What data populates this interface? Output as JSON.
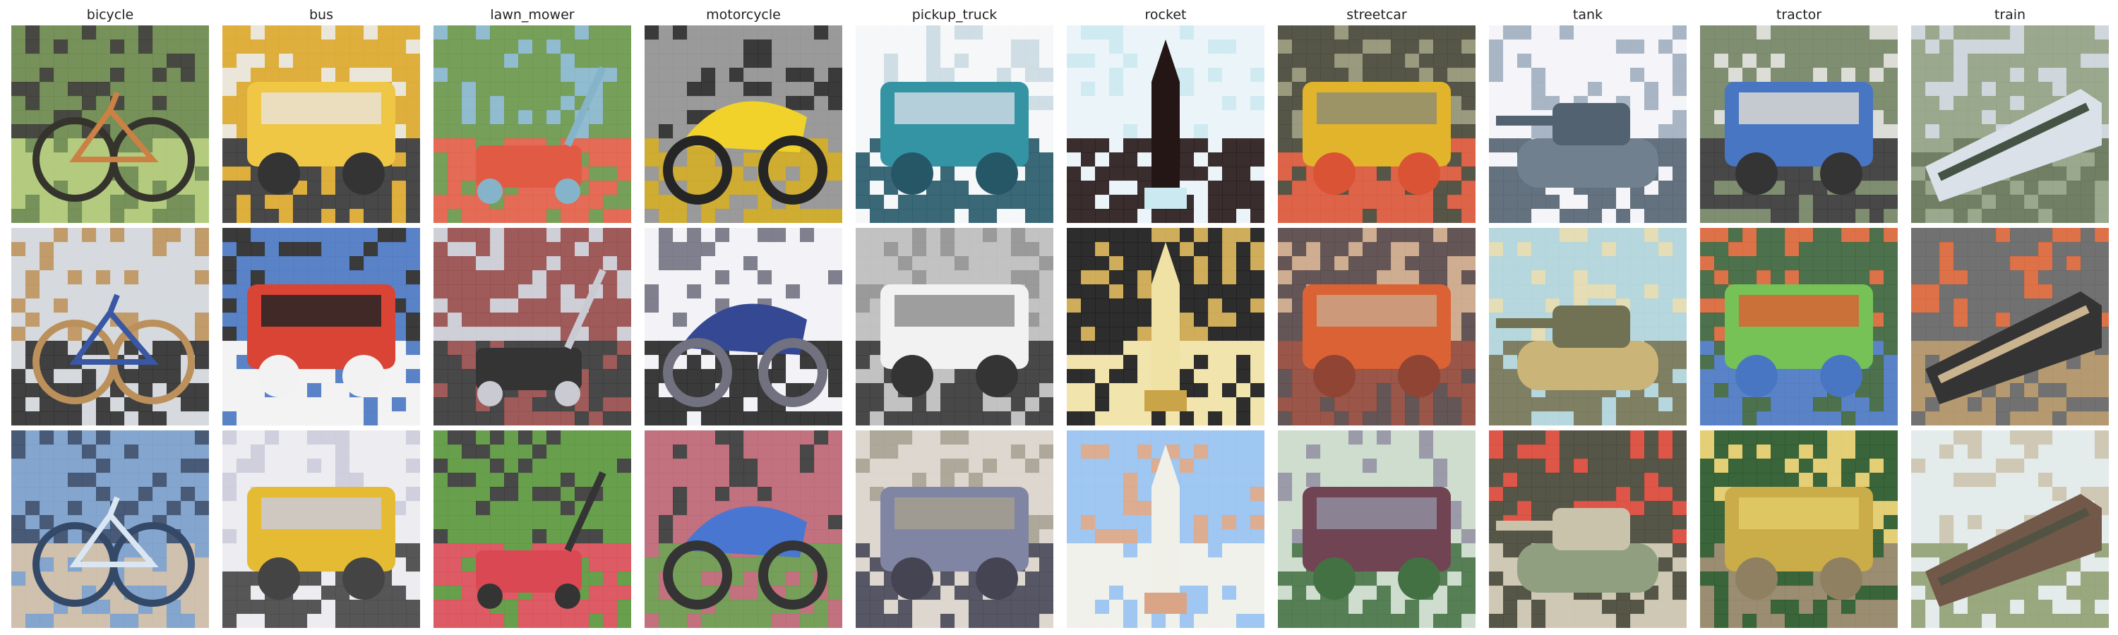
{
  "figure": {
    "columns": [
      {
        "label": "bicycle",
        "images": [
          {
            "subject": "bicycle",
            "palette": [
              "#5f7f3e",
              "#3f5a2a",
              "#a7c36a",
              "#2a2a22",
              "#c97a3a"
            ],
            "kind": "bike"
          },
          {
            "subject": "bicycle",
            "palette": [
              "#cfd5da",
              "#6a5638",
              "#202020",
              "#b88b52",
              "#2f4f9f"
            ],
            "kind": "bike"
          },
          {
            "subject": "bicycle",
            "palette": [
              "#6f97c7",
              "#9fb7cf",
              "#c8b7a0",
              "#2a3f5f",
              "#d8e6f2"
            ],
            "kind": "bike"
          }
        ]
      },
      {
        "label": "bus",
        "images": [
          {
            "subject": "bus",
            "palette": [
              "#d9a21d",
              "#f0c33b",
              "#2a2a2a",
              "#e8e2d4",
              "#7a5a1a"
            ],
            "kind": "vehicle"
          },
          {
            "subject": "bus",
            "palette": [
              "#3f6fbf",
              "#d83a2a",
              "#f2f2f2",
              "#1a1a1a",
              "#7ea7df"
            ],
            "kind": "vehicle"
          },
          {
            "subject": "bus",
            "palette": [
              "#e9e9ef",
              "#e3b828",
              "#3a3a3a",
              "#c8c8d8",
              "#6a5a2a"
            ],
            "kind": "vehicle"
          }
        ]
      },
      {
        "label": "lawn_mower",
        "images": [
          {
            "subject": "lawn_mower",
            "palette": [
              "#5f8f3f",
              "#3a5a2a",
              "#e0533a",
              "#7fb0c8",
              "#d8d2c0"
            ],
            "kind": "mower"
          },
          {
            "subject": "lawn_mower",
            "palette": [
              "#8f3f3f",
              "#6a9a4a",
              "#2a2a2a",
              "#c8c8d0",
              "#a05a4a"
            ],
            "kind": "mower"
          },
          {
            "subject": "lawn_mower",
            "palette": [
              "#4f8f2f",
              "#6fae3f",
              "#d8404a",
              "#2a2a2a",
              "#9fcf5f"
            ],
            "kind": "mower"
          }
        ]
      },
      {
        "label": "motorcycle",
        "images": [
          {
            "subject": "motorcycle",
            "palette": [
              "#8a8a8a",
              "#f0d020",
              "#c8a010",
              "#1a1a1a",
              "#d8d8d8"
            ],
            "kind": "moto"
          },
          {
            "subject": "motorcycle",
            "palette": [
              "#f2f2f6",
              "#2a3f8f",
              "#1a1a1a",
              "#6a6a7a",
              "#d8d2a0"
            ],
            "kind": "moto"
          },
          {
            "subject": "motorcycle",
            "palette": [
              "#b85a6a",
              "#3f6fcf",
              "#5f8f3f",
              "#2a2a2a",
              "#d8d8e0"
            ],
            "kind": "moto"
          }
        ]
      },
      {
        "label": "pickup_truck",
        "images": [
          {
            "subject": "pickup_truck",
            "palette": [
              "#f4f6f8",
              "#2a8fa0",
              "#1a4f5f",
              "#c8d8e0",
              "#2a2a2a"
            ],
            "kind": "vehicle"
          },
          {
            "subject": "pickup_truck",
            "palette": [
              "#b8b8b8",
              "#f2f2f2",
              "#2a2a2a",
              "#8a8a8a",
              "#6a7a5a"
            ],
            "kind": "vehicle"
          },
          {
            "subject": "pickup_truck",
            "palette": [
              "#d8d0c8",
              "#7a7fa0",
              "#3a3a4a",
              "#a09a8a",
              "#f0eee8"
            ],
            "kind": "vehicle"
          }
        ]
      },
      {
        "label": "rocket",
        "images": [
          {
            "subject": "rocket",
            "palette": [
              "#e8f4f8",
              "#4a1a1a",
              "#1a0a0a",
              "#c8e8f0",
              "#8a8a8a"
            ],
            "kind": "rocket"
          },
          {
            "subject": "rocket",
            "palette": [
              "#0a0a0a",
              "#1a1a0a",
              "#f0e0a0",
              "#c8a040",
              "#2a2a1a"
            ],
            "kind": "rocket"
          },
          {
            "subject": "rocket",
            "palette": [
              "#8fbfef",
              "#c8e0f8",
              "#f0f0e8",
              "#d8a080",
              "#6f9fdf"
            ],
            "kind": "rocket"
          }
        ]
      },
      {
        "label": "streetcar",
        "images": [
          {
            "subject": "streetcar",
            "palette": [
              "#3a3a2a",
              "#e0b020",
              "#d84a2a",
              "#8a8a6a",
              "#1a1a1a"
            ],
            "kind": "vehicle"
          },
          {
            "subject": "streetcar",
            "palette": [
              "#4a3a3a",
              "#d85a2a",
              "#8a3a2a",
              "#c8a080",
              "#2a2a2a"
            ],
            "kind": "vehicle"
          },
          {
            "subject": "streetcar",
            "palette": [
              "#c8d8c8",
              "#6a3a4a",
              "#3a6a3a",
              "#8a8a9a",
              "#e8e8e0"
            ],
            "kind": "vehicle"
          }
        ]
      },
      {
        "label": "tank",
        "images": [
          {
            "subject": "tank",
            "palette": [
              "#f4f4f8",
              "#6a7a8a",
              "#4a5a6a",
              "#9aaaba",
              "#dcdce4"
            ],
            "kind": "tank"
          },
          {
            "subject": "tank",
            "palette": [
              "#a8d0d8",
              "#c8b070",
              "#6a6a4a",
              "#e0d8a8",
              "#8a8a6a"
            ],
            "kind": "tank"
          },
          {
            "subject": "tank",
            "palette": [
              "#3a3a2a",
              "#8a9a7a",
              "#c8c0a8",
              "#d83a2a",
              "#5a6a4a"
            ],
            "kind": "tank"
          }
        ]
      },
      {
        "label": "tractor",
        "images": [
          {
            "subject": "tractor",
            "palette": [
              "#6a7a5a",
              "#3f6fbf",
              "#2a2a2a",
              "#d8d8d0",
              "#8a8a7a"
            ],
            "kind": "vehicle"
          },
          {
            "subject": "tractor",
            "palette": [
              "#2f5a2f",
              "#6fbf4f",
              "#3f6fbf",
              "#d85a2a",
              "#8ab86a"
            ],
            "kind": "vehicle"
          },
          {
            "subject": "tractor",
            "palette": [
              "#1a4a1a",
              "#c8a840",
              "#8a7a5a",
              "#e0c860",
              "#3a3a2a"
            ],
            "kind": "vehicle"
          }
        ]
      },
      {
        "label": "train",
        "images": [
          {
            "subject": "train",
            "palette": [
              "#8a9a7a",
              "#d8e0e8",
              "#5a6a4a",
              "#c8d0d8",
              "#3a4a3a"
            ],
            "kind": "train"
          },
          {
            "subject": "train",
            "palette": [
              "#5a5a5a",
              "#2a2a2a",
              "#a88a5a",
              "#d85a2a",
              "#c8b08a"
            ],
            "kind": "train"
          },
          {
            "subject": "train",
            "palette": [
              "#e0e8e8",
              "#6a5040",
              "#8a9a6a",
              "#c8c0a8",
              "#4a4a3a"
            ],
            "kind": "train"
          }
        ]
      }
    ]
  }
}
